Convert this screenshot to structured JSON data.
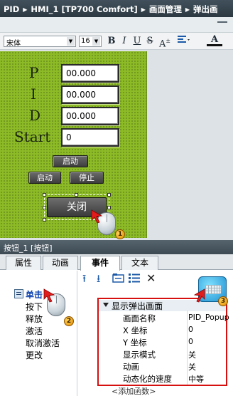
{
  "breadcrumb": [
    "PID",
    "HMI_1 [TP700 Comfort]",
    "画面管理",
    "弹出画"
  ],
  "toolbar": {
    "font_name": "宋体",
    "font_size": "16",
    "bold": "B",
    "italic": "I",
    "underline": "U",
    "strike": "S",
    "superscript": "A",
    "align_icon": "align-left-icon",
    "text_color": "A"
  },
  "screen": {
    "labels": [
      "P",
      "I",
      "D",
      "Start"
    ],
    "values": [
      "00.000",
      "00.000",
      "00.000",
      "0"
    ],
    "btn_start_on": "启动",
    "btn_start": "启动",
    "btn_stop": "停止",
    "btn_close": "关闭"
  },
  "badges": [
    "1",
    "2",
    "3"
  ],
  "panel": {
    "title": "按钮_1 [按钮]",
    "tabs": [
      "属性",
      "动画",
      "事件",
      "文本"
    ],
    "active_tab": "事件",
    "events": [
      "单击",
      "按下",
      "释放",
      "激活",
      "取消激活",
      "更改"
    ],
    "selected_event": "单击"
  },
  "function": {
    "title": "显示弹出画面",
    "params": [
      {
        "key": "画面名称",
        "value": "PID_Popup"
      },
      {
        "key": "X 坐标",
        "value": "0"
      },
      {
        "key": "Y 坐标",
        "value": "0"
      },
      {
        "key": "显示模式",
        "value": "关"
      },
      {
        "key": "动画",
        "value": "关"
      },
      {
        "key": "动态化的速度",
        "value": "中等"
      }
    ],
    "add_function": "<添加函数>"
  },
  "colors": {
    "screen_green": "#8dbb27",
    "highlight_red": "#d60f0f",
    "title_bar": "#41505c"
  }
}
